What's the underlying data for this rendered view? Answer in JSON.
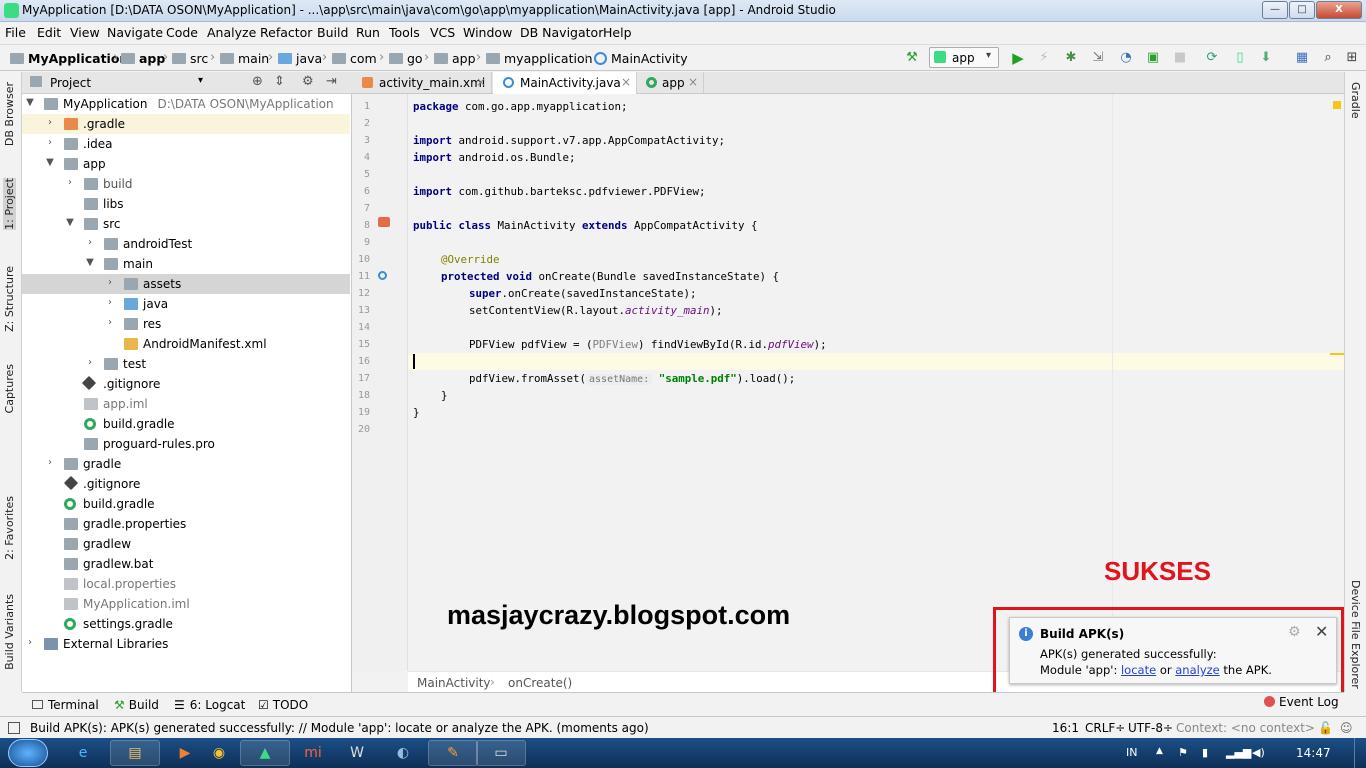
{
  "window": {
    "title": "MyApplication [D:\\DATA OSON\\MyApplication] - ...\\app\\src\\main\\java\\com\\go\\app\\myapplication\\MainActivity.java [app] - Android Studio",
    "min": "—",
    "max": "□",
    "close": "X"
  },
  "menu": [
    "File",
    "Edit",
    "View",
    "Navigate",
    "Code",
    "Analyze",
    "Refactor",
    "Build",
    "Run",
    "Tools",
    "VCS",
    "Window",
    "DB Navigator",
    "Help"
  ],
  "breadcrumb": [
    "MyApplication",
    "app",
    "src",
    "main",
    "java",
    "com",
    "go",
    "app",
    "myapplication",
    "MainActivity"
  ],
  "toolbar": {
    "run_config": "app"
  },
  "left_tabs": [
    "DB Browser",
    "1: Project",
    "Z: Structure",
    "Captures",
    "2: Favorites",
    "Build Variants"
  ],
  "right_tabs": [
    "Gradle",
    "Device File Explorer"
  ],
  "project_panel": {
    "view": "Project",
    "tree": [
      {
        "label": "MyApplication",
        "extra": "D:\\DATA OSON\\MyApplication"
      },
      {
        "label": ".gradle"
      },
      {
        "label": ".idea"
      },
      {
        "label": "app"
      },
      {
        "label": "build"
      },
      {
        "label": "libs"
      },
      {
        "label": "src"
      },
      {
        "label": "androidTest"
      },
      {
        "label": "main"
      },
      {
        "label": "assets"
      },
      {
        "label": "java"
      },
      {
        "label": "res"
      },
      {
        "label": "AndroidManifest.xml"
      },
      {
        "label": "test"
      },
      {
        "label": ".gitignore"
      },
      {
        "label": "app.iml"
      },
      {
        "label": "build.gradle"
      },
      {
        "label": "proguard-rules.pro"
      },
      {
        "label": "gradle"
      },
      {
        "label": ".gitignore"
      },
      {
        "label": "build.gradle"
      },
      {
        "label": "gradle.properties"
      },
      {
        "label": "gradlew"
      },
      {
        "label": "gradlew.bat"
      },
      {
        "label": "local.properties"
      },
      {
        "label": "MyApplication.iml"
      },
      {
        "label": "settings.gradle"
      },
      {
        "label": "External Libraries"
      }
    ]
  },
  "editor_tabs": [
    "activity_main.xml",
    "MainActivity.java",
    "app"
  ],
  "code": {
    "line_numbers": [
      "1",
      "2",
      "3",
      "4",
      "5",
      "6",
      "7",
      "8",
      "9",
      "10",
      "11",
      "12",
      "13",
      "14",
      "15",
      "16",
      "17",
      "18",
      "19",
      "20"
    ],
    "l1_kw": "package",
    "l1_rest": " com.go.app.myapplication;",
    "l3_kw": "import",
    "l3_rest": " android.support.v7.app.AppCompatActivity;",
    "l4_kw": "import",
    "l4_rest": " android.os.Bundle;",
    "l6_kw": "import",
    "l6_rest": " com.github.barteksc.pdfviewer.PDFView;",
    "l8_kw1": "public class",
    "l8_mid": " MainActivity ",
    "l8_kw2": "extends",
    "l8_rest": " AppCompatActivity {",
    "l10_an": "@Override",
    "l11_kw": "protected void",
    "l11_rest": " onCreate(Bundle savedInstanceState) {",
    "l12_kw": "super",
    "l12_rest": ".onCreate(savedInstanceState);",
    "l13_a": "setContentView(R.layout.",
    "l13_f": "activity_main",
    "l13_b": ");",
    "l15_a": "PDFView pdfView = (",
    "l15_g": "PDFView",
    "l15_b": ") findViewById(R.id.",
    "l15_f": "pdfView",
    "l15_c": ");",
    "l17_a": "pdfView.fromAsset(",
    "l17_hint": "assetName:",
    "l17_s": "\"sample.pdf\"",
    "l17_b": ").load();",
    "l18": "}",
    "l19": "}"
  },
  "editor_breadcrumb": [
    "MainActivity",
    "onCreate()"
  ],
  "overlay": {
    "watermark": "masjaycrazy.blogspot.com",
    "sukses": "SUKSES"
  },
  "notification": {
    "title": "Build APK(s)",
    "line1": "APK(s) generated successfully:",
    "line2_a": "Module 'app': ",
    "link1": "locate",
    "line2_b": " or ",
    "link2": "analyze",
    "line2_c": " the APK."
  },
  "bottom_tabs": [
    "Terminal",
    "Build",
    "6: Logcat",
    "TODO"
  ],
  "event_log": "Event Log",
  "status": {
    "message": "Build APK(s): APK(s) generated successfully: // Module 'app': locate or analyze the APK. (moments ago)",
    "position": "16:1",
    "line_sep": "CRLF÷",
    "encoding": "UTF-8÷",
    "context": "Context: <no context>"
  },
  "taskbar": {
    "lang": "IN",
    "time": "14:47"
  },
  "colors": {
    "accent_red": "#e0141c",
    "android_green": "#3ddc84",
    "keyword": "#000080",
    "string": "#008000"
  }
}
